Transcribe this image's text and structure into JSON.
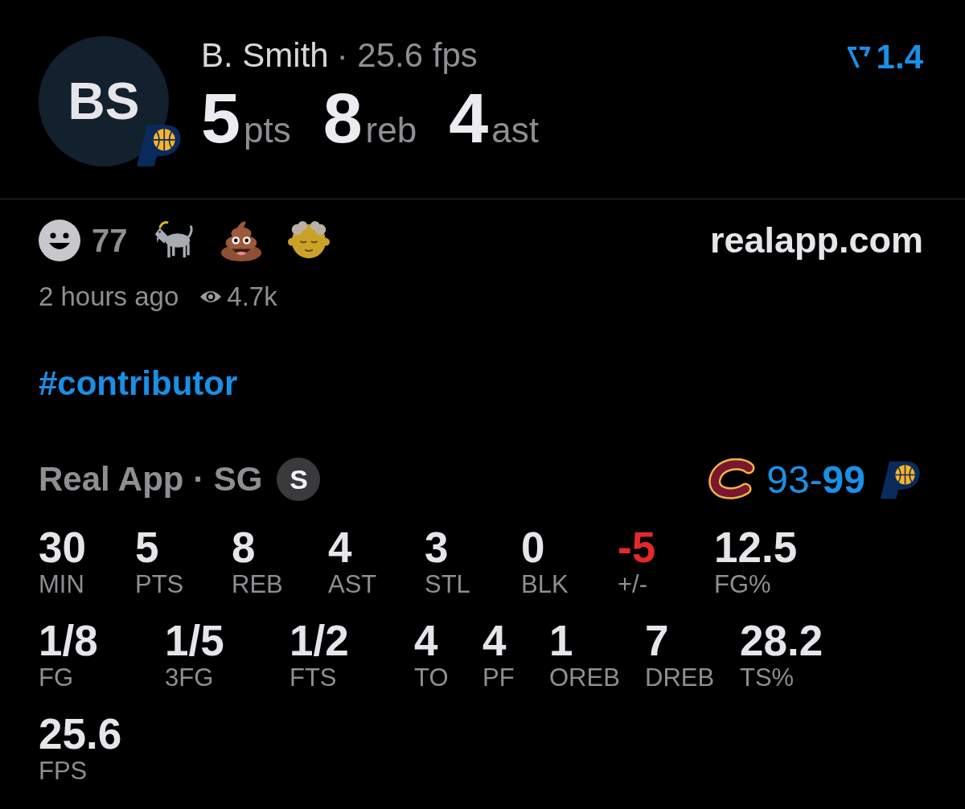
{
  "player": {
    "initials": "BS",
    "name": "B. Smith",
    "fps": "· 25.6 fps",
    "rating": "1.4",
    "totals": [
      {
        "value": "5",
        "unit": "pts"
      },
      {
        "value": "8",
        "unit": "reb"
      },
      {
        "value": "4",
        "unit": "ast"
      }
    ]
  },
  "reactions": {
    "count": "77",
    "source": "realapp.com"
  },
  "meta": {
    "posted": "2 hours ago",
    "views": "4.7k"
  },
  "hashtag": "#contributor",
  "game": {
    "team": "Real App · SG",
    "badge": "S",
    "score": "93-**99**"
  },
  "box_score": [
    [
      {
        "value": "30",
        "label": "MIN",
        "color": "#e5e5ea"
      },
      {
        "value": "5",
        "label": "PTS",
        "color": "#e5e5ea"
      },
      {
        "value": "8",
        "label": "REB",
        "color": "#e5e5ea"
      },
      {
        "value": "4",
        "label": "AST",
        "color": "#e5e5ea"
      },
      {
        "value": "3",
        "label": "STL",
        "color": "#e5e5ea"
      },
      {
        "value": "0",
        "label": "BLK",
        "color": "#e5e5ea"
      },
      {
        "value": "-5",
        "label": "+/-",
        "color": "#e5282b"
      },
      {
        "value": "12.5",
        "label": "FG%",
        "color": "#e5e5ea"
      }
    ],
    [
      {
        "value": "1/8",
        "label": "FG",
        "color": "#e5e5ea"
      },
      {
        "value": "1/5",
        "label": "3FG",
        "color": "#e5e5ea"
      },
      {
        "value": "1/2",
        "label": "FTS",
        "color": "#e5e5ea"
      },
      {
        "value": "4",
        "label": "TO",
        "color": "#e5e5ea"
      },
      {
        "value": "4",
        "label": "PF",
        "color": "#e5e5ea"
      },
      {
        "value": "1",
        "label": "OREB",
        "color": "#e5e5ea"
      },
      {
        "value": "7",
        "label": "DREB",
        "color": "#e5e5ea"
      },
      {
        "value": "28.2",
        "label": "TS%",
        "color": "#e5e5ea"
      }
    ],
    [
      {
        "value": "25.6",
        "label": "FPS",
        "color": "#e5e5ea"
      }
    ]
  ]
}
